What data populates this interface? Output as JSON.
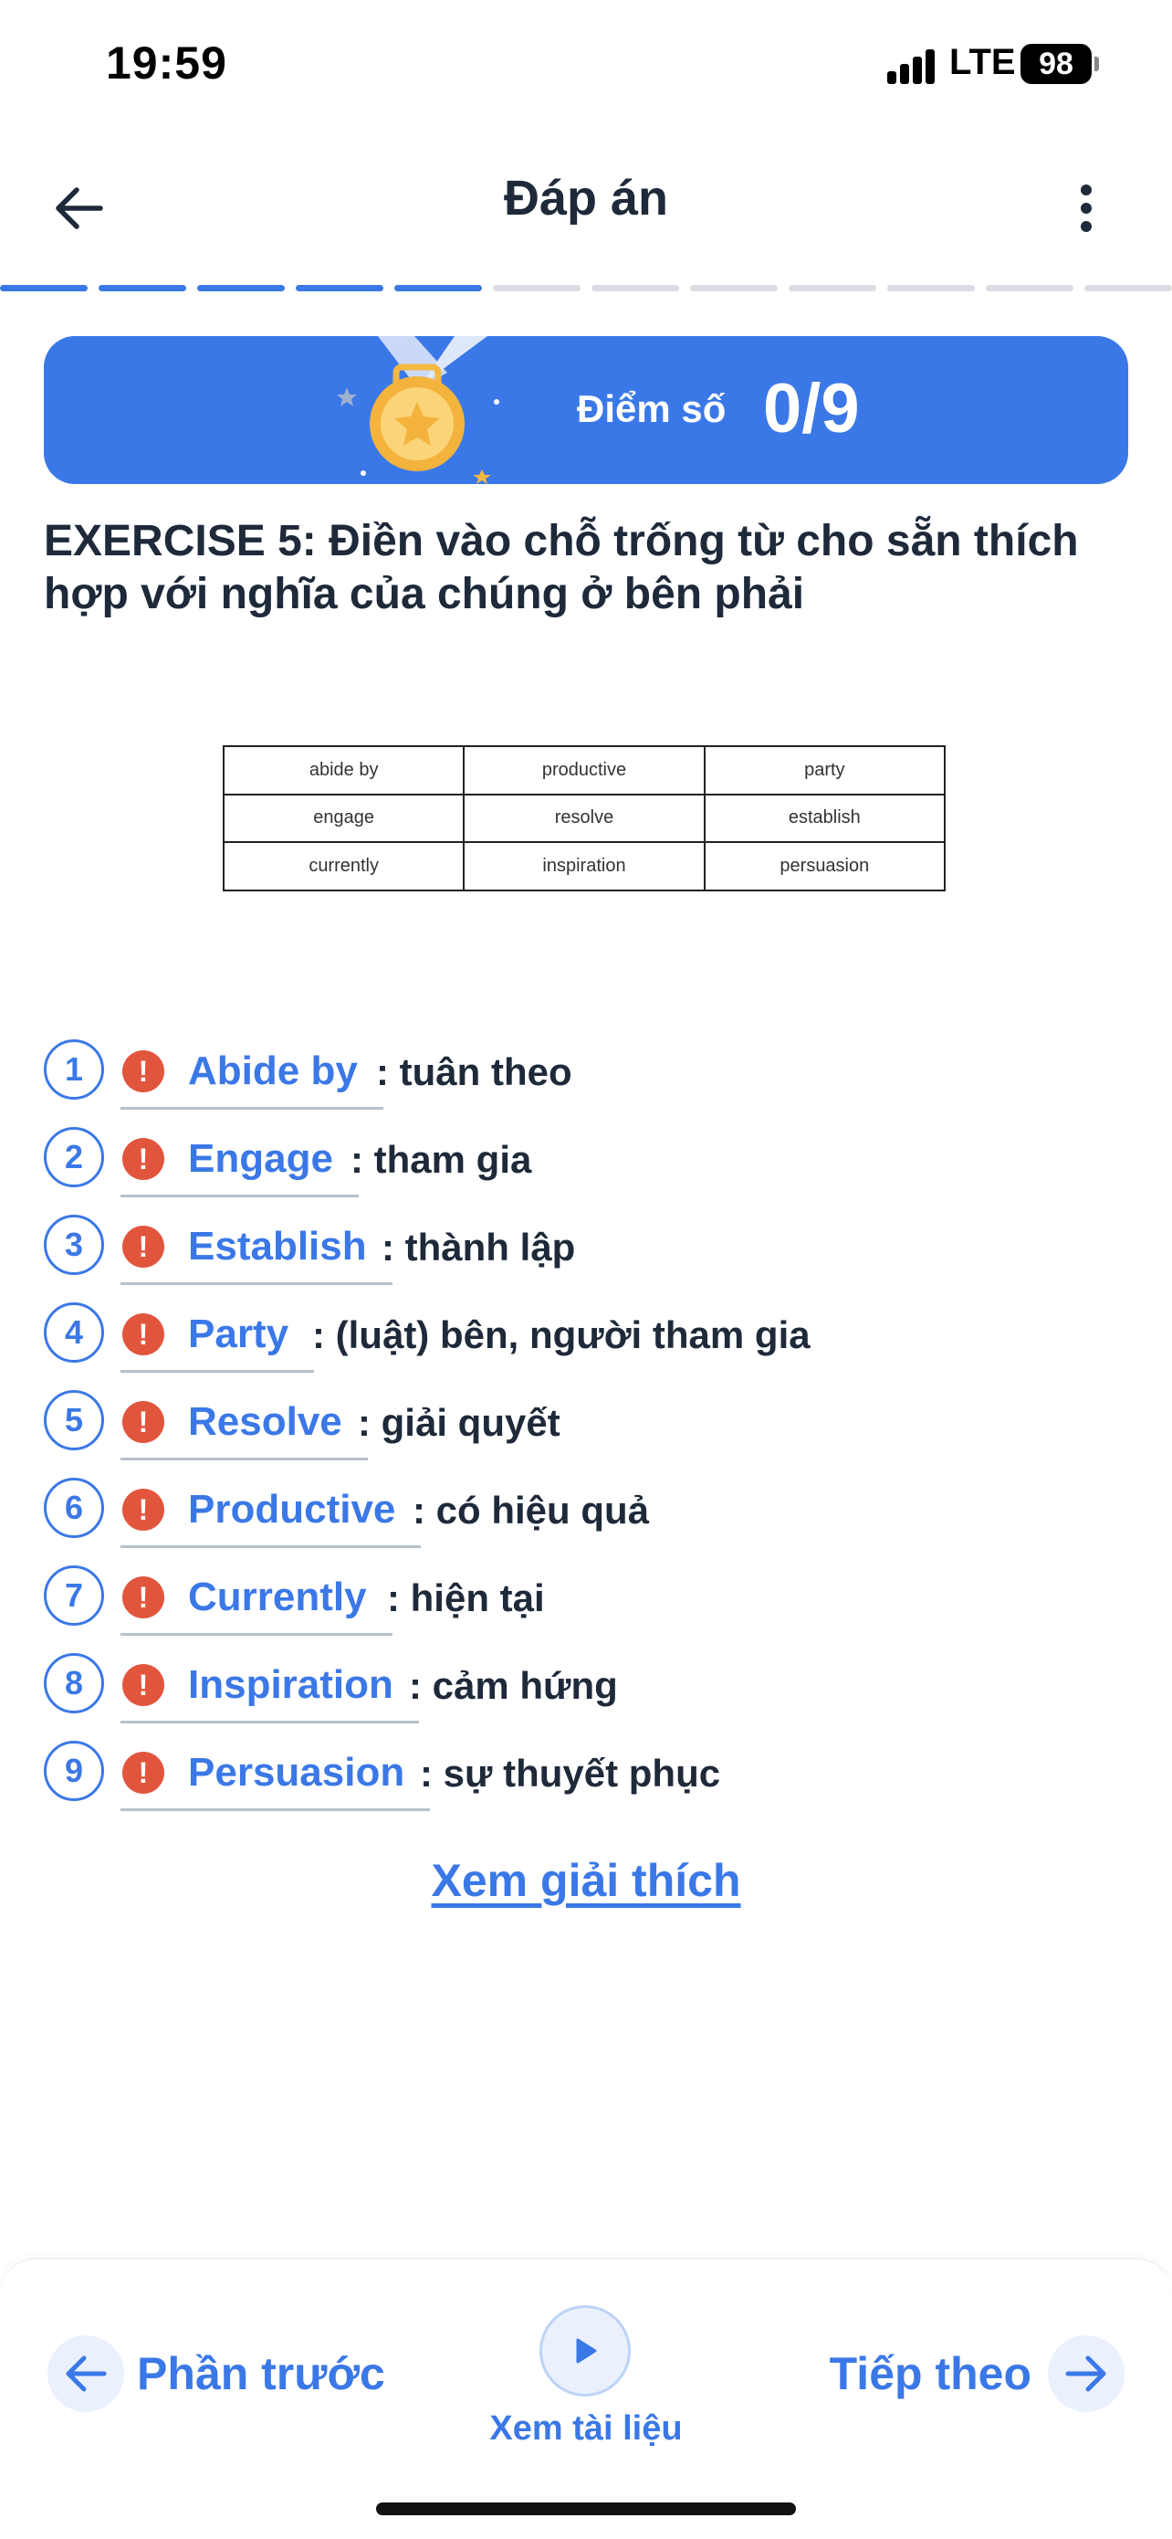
{
  "status": {
    "time": "19:59",
    "network": "LTE",
    "battery": "98"
  },
  "header": {
    "title": "Đáp án"
  },
  "progress": {
    "total_segments": 12,
    "completed_segments": 5,
    "active_color": "#3b78e7",
    "inactive_color": "#d9dde3"
  },
  "score": {
    "label": "Điểm số",
    "value": "0/9",
    "banner_color": "#3b78e7"
  },
  "exercise": {
    "title": "EXERCISE 5: Điền vào chỗ trống từ cho sẵn thích hợp với nghĩa của chúng ở bên phải",
    "word_table": [
      [
        "abide by",
        "productive",
        "party"
      ],
      [
        "engage",
        "resolve",
        "establish"
      ],
      [
        "currently",
        "inspiration",
        "persuasion"
      ]
    ]
  },
  "answers": [
    {
      "number": "1",
      "word": "Abide by",
      "meaning": ": tuân theo"
    },
    {
      "number": "2",
      "word": "Engage",
      "meaning": ": tham gia"
    },
    {
      "number": "3",
      "word": "Establish",
      "meaning": ": thành lập"
    },
    {
      "number": "4",
      "word": "Party",
      "meaning": ": (luật) bên, người tham gia"
    },
    {
      "number": "5",
      "word": "Resolve",
      "meaning": ": giải quyết"
    },
    {
      "number": "6",
      "word": "Productive",
      "meaning": ": có hiệu quả"
    },
    {
      "number": "7",
      "word": "Currently",
      "meaning": ": hiện tại"
    },
    {
      "number": "8",
      "word": "Inspiration",
      "meaning": ": cảm hứng"
    },
    {
      "number": "9",
      "word": "Persuasion",
      "meaning": ": sự thuyết phục"
    }
  ],
  "explain_link": "Xem giải thích",
  "bottom_nav": {
    "prev_label": "Phần trước",
    "doc_label": "Xem tài liệu",
    "next_label": "Tiếp theo"
  },
  "colors": {
    "accent": "#3b78e7",
    "warning": "#e2553d",
    "text": "#1e2a3a"
  },
  "icons": {
    "back": "arrow-left-icon",
    "more": "more-vertical-icon",
    "medal": "medal-icon",
    "warning": "exclamation-icon",
    "prev": "arrow-left-icon",
    "play": "play-icon",
    "next": "arrow-right-icon"
  }
}
